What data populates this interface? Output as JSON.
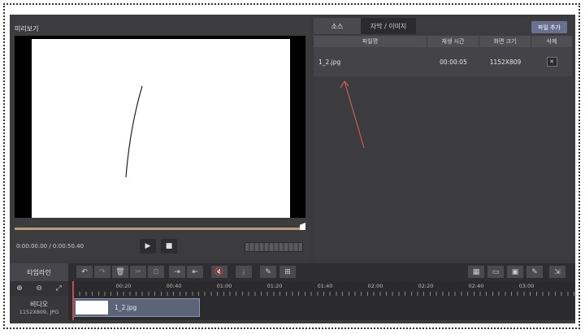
{
  "preview": {
    "title": "미리보기",
    "timecode": "0:00:00.00 / 0:00:50.40",
    "play_icon": "play-icon",
    "stop_icon": "stop-icon"
  },
  "source": {
    "tabs": [
      "소스",
      "자막 / 이미지"
    ],
    "add_file_label": "파일 추가",
    "columns": [
      "파일명",
      "재생 시간",
      "화면 크기",
      "삭제"
    ],
    "rows": [
      {
        "filename": "1_2.jpg",
        "duration": "00:00:05",
        "size": "1152X809",
        "delete": "✕"
      }
    ]
  },
  "timeline": {
    "label": "타임라인",
    "ruler_labels": [
      "00:20",
      "00:40",
      "01:00",
      "01:20",
      "01:40",
      "02:00",
      "02:20",
      "02:40",
      "03:00"
    ],
    "track": {
      "name": "비디오",
      "info": "1152X809, JPG"
    },
    "clip": {
      "label": "1_2.jpg"
    }
  },
  "colors": {
    "accent": "#6a7090",
    "playhead": "#c94a4a",
    "annotation_arrow": "#c85a5a"
  }
}
